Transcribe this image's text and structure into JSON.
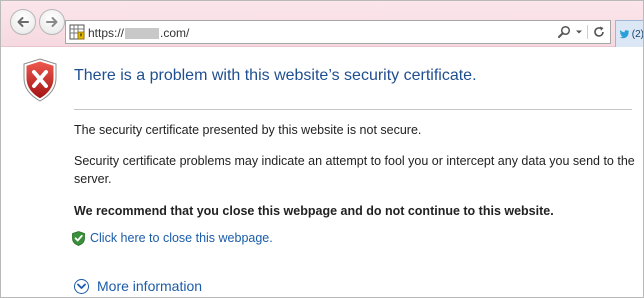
{
  "browser": {
    "url_prefix": "https://",
    "url_suffix": ".com/",
    "tab_count_label": "(2)"
  },
  "page": {
    "title": "There is a problem with this website’s security certificate.",
    "paragraph_1": "The security certificate presented by this website is not secure.",
    "paragraph_2": "Security certificate problems may indicate an attempt to fool you or intercept any data you send to the server.",
    "recommendation": "We recommend that you close this webpage and do not continue to this website.",
    "close_link": "Click here to close this webpage.",
    "more_info_link": "More information"
  },
  "colors": {
    "title_blue": "#1f4f91",
    "link_blue": "#1b5ca9",
    "shield_red": "#c62828",
    "check_green": "#3a8f3a",
    "toolbar_pink": "#f6d9e0"
  },
  "icons": {
    "back": "back-arrow-icon",
    "forward": "forward-arrow-icon",
    "certificate": "certificate-error-icon",
    "search": "search-icon",
    "dropdown": "chevron-down-icon",
    "refresh": "refresh-icon",
    "tab_site": "twitter-bird-icon",
    "error_shield": "error-shield-icon",
    "check_shield": "check-shield-icon",
    "expand": "chevron-down-circle-icon"
  }
}
